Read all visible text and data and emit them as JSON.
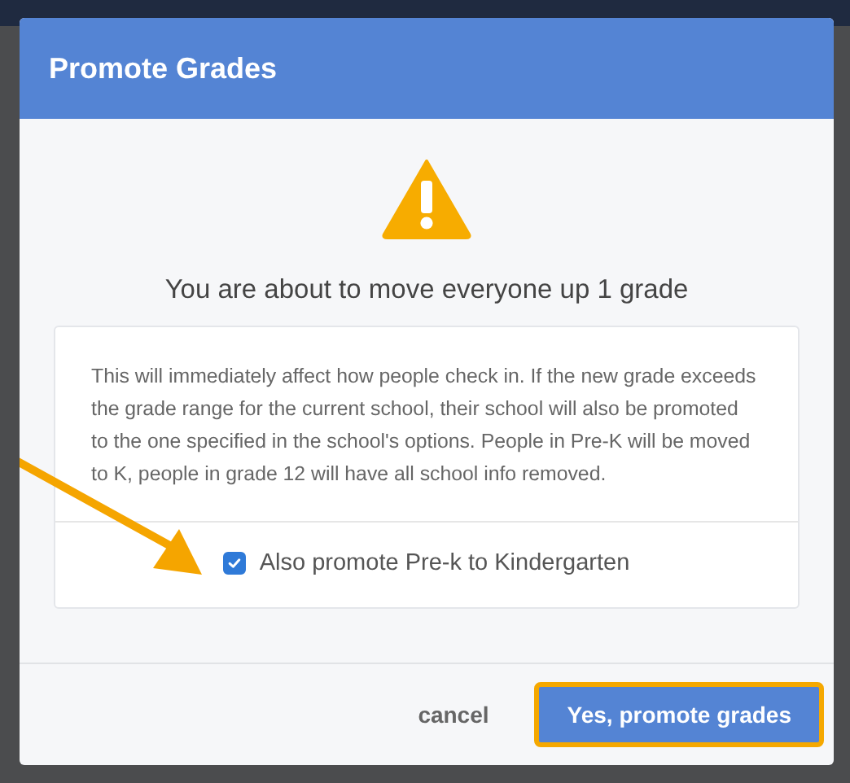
{
  "dialog": {
    "title": "Promote Grades",
    "heading": "You are about to move everyone up 1 grade",
    "message": "This will immediately affect how people check in. If the new grade exceeds the grade range for the current school, their school will also be promoted to the one specified in the school's options. People in Pre-K will be moved to K, people in grade 12 will have all school info removed.",
    "checkbox": {
      "label": "Also promote Pre-k to Kindergarten",
      "checked": true
    },
    "buttons": [
      {
        "label": "cancel",
        "kind": "link",
        "highlighted": false
      },
      {
        "label": "Yes, promote grades",
        "kind": "primary",
        "highlighted": true
      }
    ]
  }
}
